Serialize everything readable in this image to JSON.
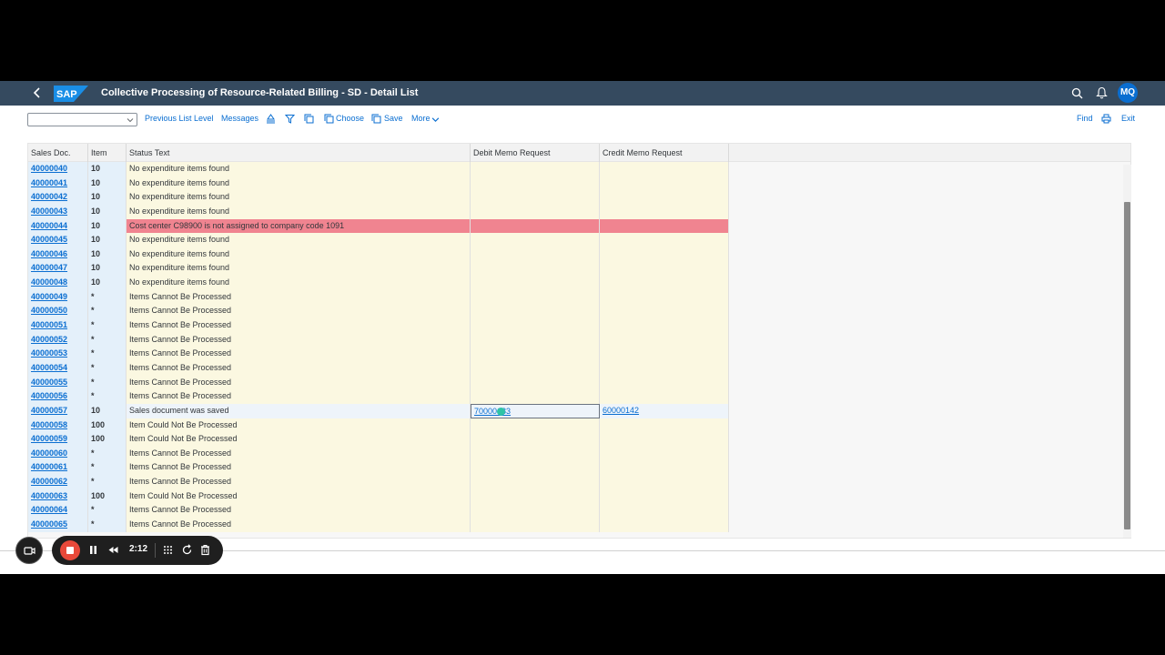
{
  "shell": {
    "title": "Collective Processing of Resource-Related Billing - SD - Detail List",
    "logo_text": "SAP",
    "avatar": "MQ"
  },
  "toolbar": {
    "select_value": "",
    "previous_list_level": "Previous List Level",
    "messages": "Messages",
    "choose": "Choose",
    "save": "Save",
    "more": "More",
    "find": "Find",
    "exit": "Exit"
  },
  "table": {
    "columns": [
      "Sales Doc.",
      "Item",
      "Status Text",
      "Debit Memo Request",
      "Credit Memo Request"
    ],
    "rows": [
      {
        "doc": "40000040",
        "item": "10",
        "status": "No expenditure items found",
        "debit": "",
        "credit": ""
      },
      {
        "doc": "40000041",
        "item": "10",
        "status": "No expenditure items found",
        "debit": "",
        "credit": ""
      },
      {
        "doc": "40000042",
        "item": "10",
        "status": "No expenditure items found",
        "debit": "",
        "credit": ""
      },
      {
        "doc": "40000043",
        "item": "10",
        "status": "No expenditure items found",
        "debit": "",
        "credit": ""
      },
      {
        "doc": "40000044",
        "item": "10",
        "status": "Cost center C98900 is not assigned to company code  1091",
        "debit": "",
        "credit": "",
        "state": "error"
      },
      {
        "doc": "40000045",
        "item": "10",
        "status": "No expenditure items found",
        "debit": "",
        "credit": ""
      },
      {
        "doc": "40000046",
        "item": "10",
        "status": "No expenditure items found",
        "debit": "",
        "credit": ""
      },
      {
        "doc": "40000047",
        "item": "10",
        "status": "No expenditure items found",
        "debit": "",
        "credit": ""
      },
      {
        "doc": "40000048",
        "item": "10",
        "status": "No expenditure items found",
        "debit": "",
        "credit": ""
      },
      {
        "doc": "40000049",
        "item": "*",
        "status": "Items Cannot Be Processed",
        "debit": "",
        "credit": ""
      },
      {
        "doc": "40000050",
        "item": "*",
        "status": "Items Cannot Be Processed",
        "debit": "",
        "credit": ""
      },
      {
        "doc": "40000051",
        "item": "*",
        "status": "Items Cannot Be Processed",
        "debit": "",
        "credit": ""
      },
      {
        "doc": "40000052",
        "item": "*",
        "status": "Items Cannot Be Processed",
        "debit": "",
        "credit": ""
      },
      {
        "doc": "40000053",
        "item": "*",
        "status": "Items Cannot Be Processed",
        "debit": "",
        "credit": ""
      },
      {
        "doc": "40000054",
        "item": "*",
        "status": "Items Cannot Be Processed",
        "debit": "",
        "credit": ""
      },
      {
        "doc": "40000055",
        "item": "*",
        "status": "Items Cannot Be Processed",
        "debit": "",
        "credit": ""
      },
      {
        "doc": "40000056",
        "item": "*",
        "status": "Items Cannot Be Processed",
        "debit": "",
        "credit": ""
      },
      {
        "doc": "40000057",
        "item": "10",
        "status": "Sales document was saved",
        "debit": "70000183",
        "credit": "60000142",
        "state": "selected"
      },
      {
        "doc": "40000058",
        "item": "100",
        "status": "Item Could Not Be Processed",
        "debit": "",
        "credit": ""
      },
      {
        "doc": "40000059",
        "item": "100",
        "status": "Item Could Not Be Processed",
        "debit": "",
        "credit": ""
      },
      {
        "doc": "40000060",
        "item": "*",
        "status": "Items Cannot Be Processed",
        "debit": "",
        "credit": ""
      },
      {
        "doc": "40000061",
        "item": "*",
        "status": "Items Cannot Be Processed",
        "debit": "",
        "credit": ""
      },
      {
        "doc": "40000062",
        "item": "*",
        "status": "Items Cannot Be Processed",
        "debit": "",
        "credit": ""
      },
      {
        "doc": "40000063",
        "item": "100",
        "status": "Item Could Not Be Processed",
        "debit": "",
        "credit": ""
      },
      {
        "doc": "40000064",
        "item": "*",
        "status": "Items Cannot Be Processed",
        "debit": "",
        "credit": ""
      },
      {
        "doc": "40000065",
        "item": "*",
        "status": "Items Cannot Be Processed",
        "debit": "",
        "credit": ""
      }
    ]
  },
  "recorder": {
    "time": "2:12"
  },
  "colors": {
    "shell": "#354a5f",
    "accent": "#0a6ed1",
    "error_row": "#f08490",
    "key_col": "#e4f0fa",
    "data_col": "#fbf8e1",
    "record": "#e8493a"
  }
}
